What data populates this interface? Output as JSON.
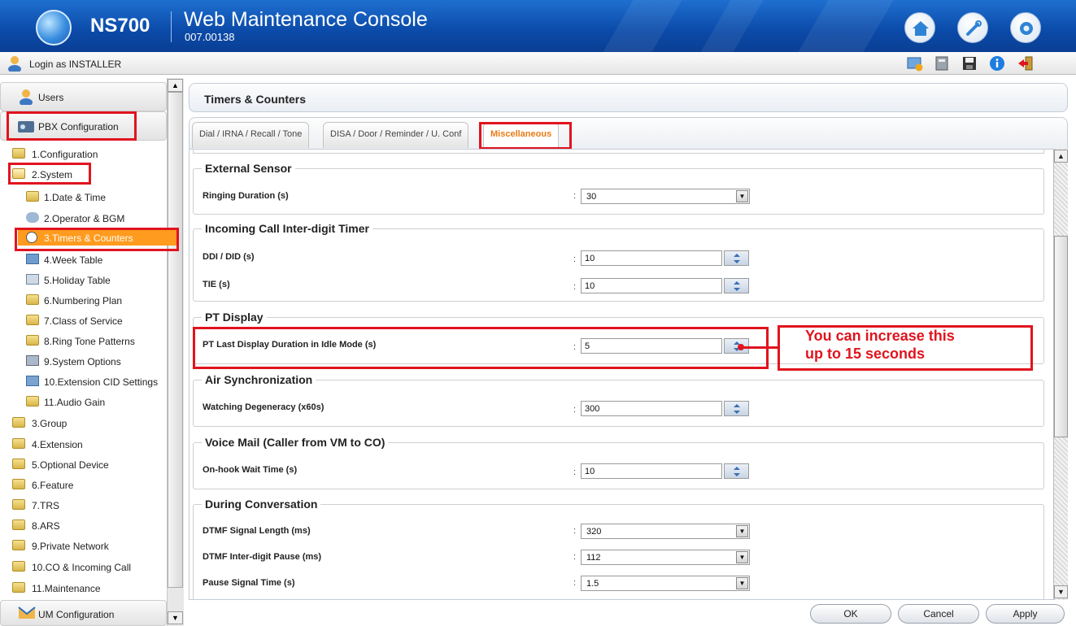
{
  "header": {
    "product": "NS700",
    "title": "Web Maintenance Console",
    "version": "007.00138"
  },
  "header_buttons": [
    "home-icon",
    "wrench-icon",
    "gear-icon"
  ],
  "loginbar": {
    "text": "Login as INSTALLER",
    "tools": [
      "maintenance-icon",
      "phonebook-icon",
      "save-icon",
      "info-icon",
      "logout-icon"
    ]
  },
  "sidebar": {
    "users": "Users",
    "pbx": "PBX Configuration",
    "um": "UM Configuration",
    "items": [
      {
        "label": "1.Configuration"
      },
      {
        "label": "2.System"
      },
      {
        "label": "1.Date & Time"
      },
      {
        "label": "2.Operator & BGM"
      },
      {
        "label": "3.Timers & Counters"
      },
      {
        "label": "4.Week Table"
      },
      {
        "label": "5.Holiday Table"
      },
      {
        "label": "6.Numbering Plan"
      },
      {
        "label": "7.Class of Service"
      },
      {
        "label": "8.Ring Tone Patterns"
      },
      {
        "label": "9.System Options"
      },
      {
        "label": "10.Extension CID Settings"
      },
      {
        "label": "11.Audio Gain"
      },
      {
        "label": "3.Group"
      },
      {
        "label": "4.Extension"
      },
      {
        "label": "5.Optional Device"
      },
      {
        "label": "6.Feature"
      },
      {
        "label": "7.TRS"
      },
      {
        "label": "8.ARS"
      },
      {
        "label": "9.Private Network"
      },
      {
        "label": "10.CO & Incoming Call"
      },
      {
        "label": "11.Maintenance"
      }
    ]
  },
  "main": {
    "title": "Timers & Counters",
    "tabs": [
      {
        "label": "Dial / IRNA / Recall / Tone"
      },
      {
        "label": "DISA / Door / Reminder / U. Conf"
      },
      {
        "label": "Miscellaneous"
      }
    ],
    "groups": [
      {
        "title": "External Sensor",
        "rows": [
          {
            "label": "Ringing Duration (s)",
            "value": "30",
            "type": "select"
          }
        ]
      },
      {
        "title": "Incoming Call Inter-digit Timer",
        "rows": [
          {
            "label": "DDI / DID (s)",
            "value": "10",
            "type": "spin"
          },
          {
            "label": "TIE (s)",
            "value": "10",
            "type": "spin"
          }
        ]
      },
      {
        "title": "PT Display",
        "rows": [
          {
            "label": "PT Last Display Duration in Idle Mode (s)",
            "value": "5",
            "type": "spin"
          }
        ]
      },
      {
        "title": "Air Synchronization",
        "rows": [
          {
            "label": "Watching Degeneracy (x60s)",
            "value": "300",
            "type": "spin"
          }
        ]
      },
      {
        "title": "Voice Mail (Caller from VM to CO)",
        "rows": [
          {
            "label": "On-hook Wait Time (s)",
            "value": "10",
            "type": "spin"
          }
        ]
      },
      {
        "title": "During Conversation",
        "rows": [
          {
            "label": "DTMF Signal Length (ms)",
            "value": "320",
            "type": "select"
          },
          {
            "label": "DTMF Inter-digit Pause (ms)",
            "value": "112",
            "type": "select"
          },
          {
            "label": "Pause Signal Time (s)",
            "value": "1.5",
            "type": "select"
          }
        ]
      }
    ]
  },
  "callout": {
    "line1": "You can increase this",
    "line2": "up to 15 seconds"
  },
  "footer": {
    "ok": "OK",
    "cancel": "Cancel",
    "apply": "Apply"
  },
  "colors": {
    "accent_red": "#e0141e",
    "header_blue": "#0b4aa8",
    "active_tab": "#e87b14"
  }
}
